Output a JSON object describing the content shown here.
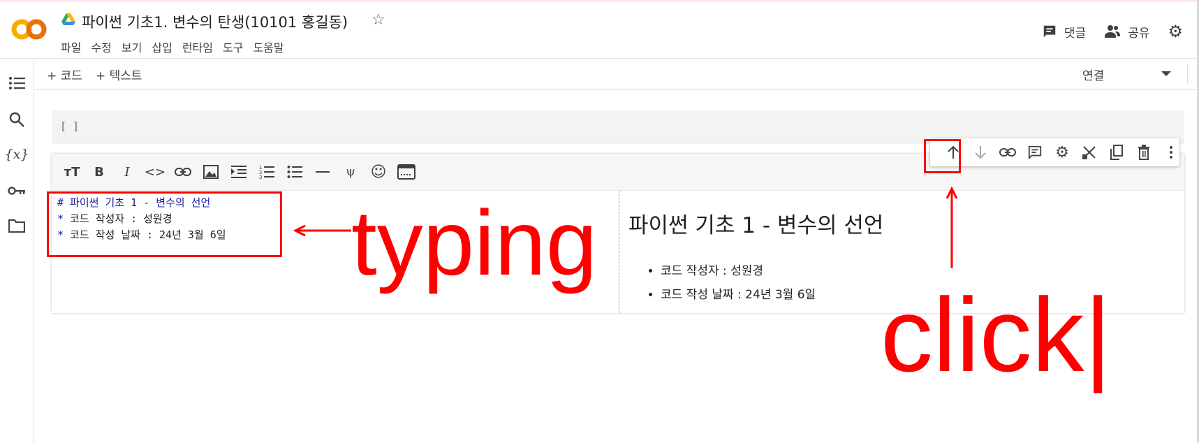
{
  "header": {
    "title": "파이썬 기초1. 변수의 탄생(10101 홍길동)",
    "comment_label": "댓글",
    "share_label": "공유",
    "menu": [
      "파일",
      "수정",
      "보기",
      "삽입",
      "런타임",
      "도구",
      "도움말"
    ]
  },
  "toolbar": {
    "add_code": "+ 코드",
    "add_text": "+ 텍스트",
    "connect": "연결"
  },
  "code_cell": {
    "brackets": "[ ]"
  },
  "text_cell": {
    "source_lines": {
      "l1": "# 파이썬 기초 1 - 변수의 선언",
      "l2_star": "*",
      "l2": " 코드 작성자 : 성원경",
      "l3_star": "*",
      "l3": " 코드 작성 날짜 : 24년 3월 6일"
    },
    "preview": {
      "heading": "파이썬 기초 1 - 변수의 선언",
      "items": [
        "코드 작성자 : 성원경",
        "코드 작성 날짜 : 24년 3월 6일"
      ]
    }
  },
  "annotations": {
    "typing": "typing",
    "click": "click|"
  },
  "colors": {
    "annotation": "#ff0000",
    "markdown_syntax": "#1a1aa6",
    "logo_orange": "#f9ab00",
    "logo_dark_orange": "#e8710a"
  }
}
